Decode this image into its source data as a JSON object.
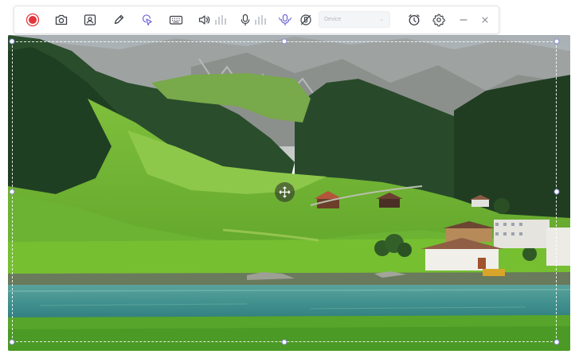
{
  "toolbar": {
    "buttons": [
      {
        "name": "record-button",
        "icon": "record-icon"
      },
      {
        "name": "screenshot-button",
        "icon": "camera-icon"
      },
      {
        "name": "webcam-button",
        "icon": "webcam-icon"
      },
      {
        "name": "annotate-button",
        "icon": "pen-icon"
      },
      {
        "name": "cursor-highlight-button",
        "icon": "cursor-click-icon"
      },
      {
        "name": "keystroke-button",
        "icon": "keyboard-icon"
      },
      {
        "name": "system-audio-button",
        "icon": "speaker-icon"
      },
      {
        "name": "microphone-button",
        "icon": "microphone-icon"
      },
      {
        "name": "noise-reduction-button",
        "icon": "ai-voice-icon"
      },
      {
        "name": "mic-off-button",
        "icon": "mic-slash-icon"
      },
      {
        "name": "schedule-button",
        "icon": "alarm-clock-icon"
      },
      {
        "name": "settings-button",
        "icon": "gear-icon"
      },
      {
        "name": "minimize-button",
        "icon": "minimize-icon"
      },
      {
        "name": "close-button",
        "icon": "close-icon"
      }
    ],
    "device_select": {
      "placeholder": "Device"
    },
    "colors": {
      "record": "#e5333b",
      "icon": "#3c3f47",
      "accent": "#6a64d8",
      "level_bar": "#c9cbd2"
    }
  },
  "capture": {
    "scene": "mountain-village-lake-landscape",
    "selection_border": "#ffffff",
    "handle_border": "#8a8ecf"
  }
}
